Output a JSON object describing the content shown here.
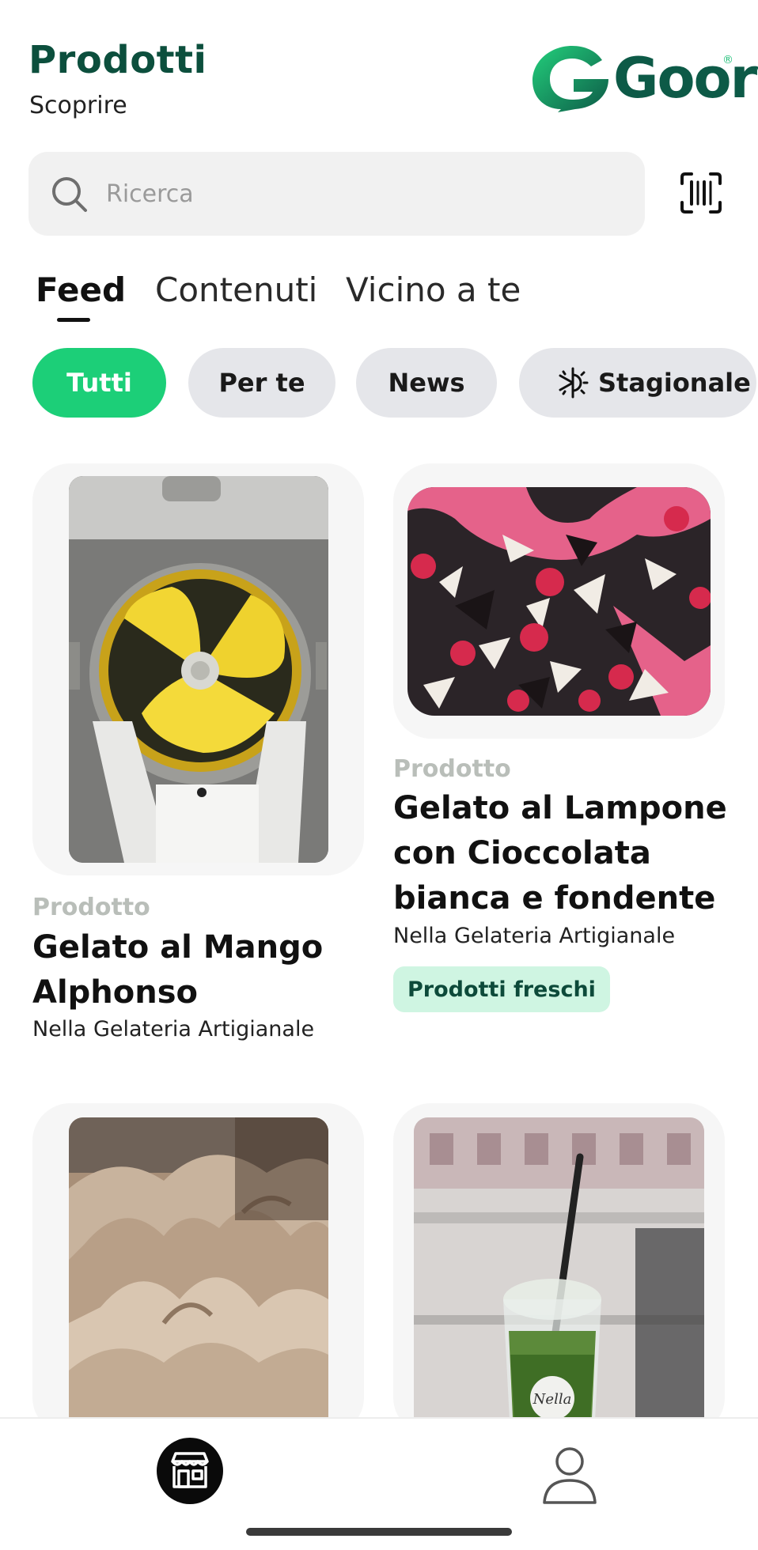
{
  "header": {
    "title": "Prodotti",
    "subtitle": "Scoprire",
    "logo_text": "Goory"
  },
  "search": {
    "placeholder": "Ricerca"
  },
  "tabs": [
    {
      "label": "Feed",
      "active": true
    },
    {
      "label": "Contenuti",
      "active": false
    },
    {
      "label": "Vicino a te",
      "active": false
    }
  ],
  "chips": [
    {
      "label": "Tutti",
      "active": true
    },
    {
      "label": "Per te",
      "active": false
    },
    {
      "label": "News",
      "active": false
    },
    {
      "label": "Stagionale",
      "active": false,
      "icon": "snowflake-sun-icon"
    }
  ],
  "cards": [
    {
      "kicker": "Prodotto",
      "title": "Gelato al Mango Alphonso",
      "subtitle": "Nella Gelateria Artigianale",
      "image": "mango-gelato-machine"
    },
    {
      "kicker": "Prodotto",
      "title": "Gelato al Lampone con Cioccolata bianca e fondente",
      "subtitle": "Nella Gelateria Artigianale",
      "badge": "Prodotti freschi",
      "image": "raspberry-chocolate-gelato"
    },
    {
      "image": "coffee-gelato-swirls"
    },
    {
      "image": "matcha-drink-cup",
      "cup_text": "Nella"
    }
  ],
  "bottom_nav": [
    {
      "name": "store-icon",
      "active": true
    },
    {
      "name": "profile-icon",
      "active": false
    }
  ],
  "colors": {
    "brand_dark": "#0c4f3d",
    "accent_green": "#1ccf78",
    "badge_bg": "#cff5e2",
    "chip_bg": "#e5e6ea"
  }
}
